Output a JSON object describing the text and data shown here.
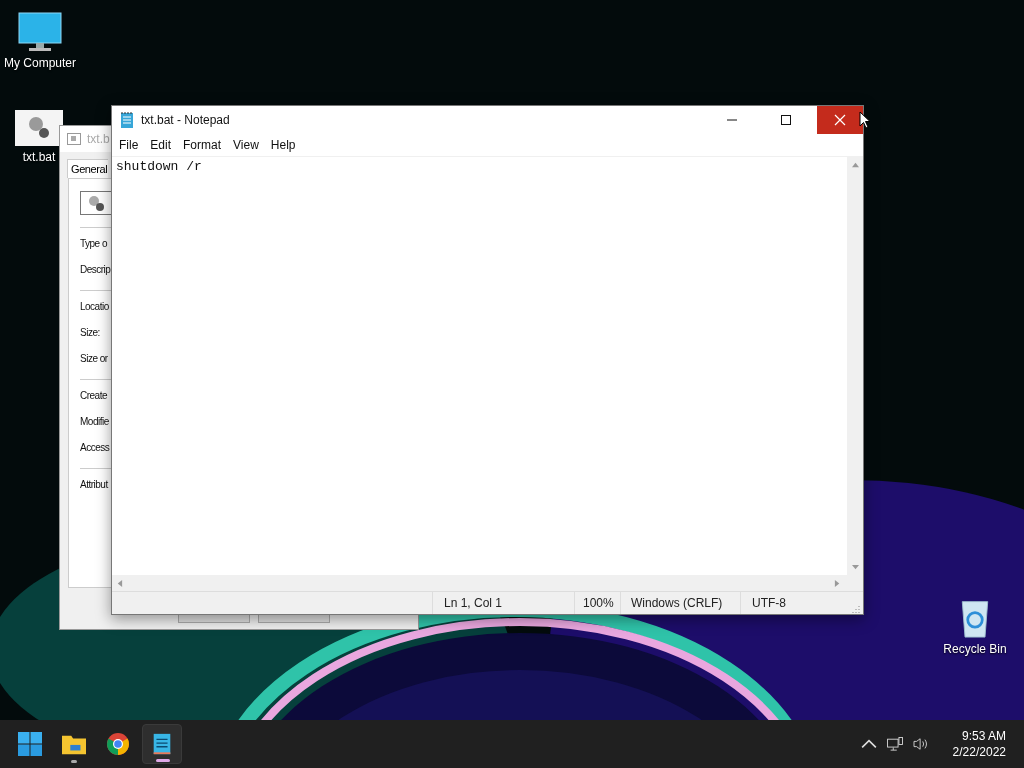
{
  "desktop_icons": [
    {
      "kind": "computer",
      "label": "My Computer"
    },
    {
      "kind": "batch",
      "label": "txt.bat"
    },
    {
      "kind": "recycle",
      "label": "Recycle Bin"
    }
  ],
  "properties_dialog": {
    "title": "txt.b",
    "tabs": [
      {
        "label": "General",
        "selected": true
      }
    ],
    "fields": [
      "Type o",
      "Descrip",
      "Locatio",
      "Size:",
      "Size or",
      "Create",
      "Modifie",
      "Access",
      "Attribut"
    ]
  },
  "notepad": {
    "title": "txt.bat - Notepad",
    "menu": [
      "File",
      "Edit",
      "Format",
      "View",
      "Help"
    ],
    "content": "shutdown /r",
    "status_bar": [
      "Ln 1, Col 1",
      "100%",
      "Windows (CRLF)",
      "UTF-8"
    ]
  },
  "taskbar": {
    "apps": [
      {
        "kind": "start",
        "running": false,
        "selected": false
      },
      {
        "kind": "explorer",
        "running": true,
        "selected": false
      },
      {
        "kind": "chrome",
        "running": false,
        "selected": false
      },
      {
        "kind": "notepad",
        "running": true,
        "selected": true
      }
    ],
    "time": "9:53 AM",
    "date": "2/22/2022"
  }
}
